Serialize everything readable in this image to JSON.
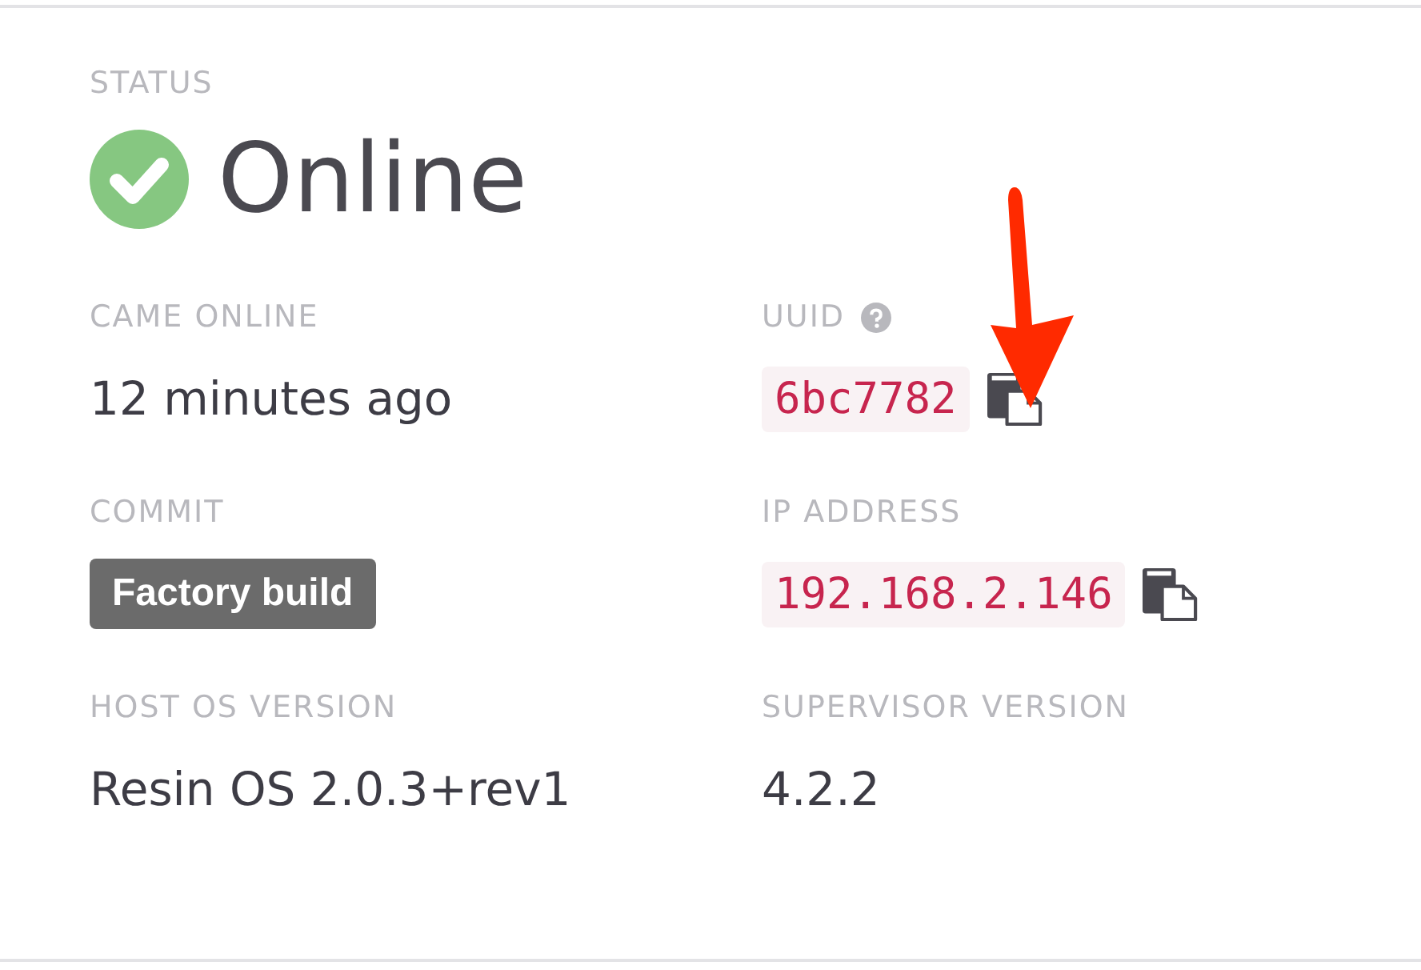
{
  "status": {
    "label": "STATUS",
    "online": true,
    "text": "Online"
  },
  "fields": [
    {
      "label": "CAME ONLINE",
      "value": "12 minutes ago",
      "kind": "text",
      "help": false,
      "copy": false
    },
    {
      "label": "UUID",
      "value": "6bc7782",
      "kind": "code",
      "help": true,
      "copy": true
    },
    {
      "label": "COMMIT",
      "value": "Factory build",
      "kind": "badge",
      "help": false,
      "copy": false
    },
    {
      "label": "IP ADDRESS",
      "value": "192.168.2.146",
      "kind": "code",
      "help": false,
      "copy": true
    },
    {
      "label": "HOST OS VERSION",
      "value": "Resin OS 2.0.3+rev1",
      "kind": "text",
      "help": false,
      "copy": false
    },
    {
      "label": "SUPERVISOR VERSION",
      "value": "4.2.2",
      "kind": "text",
      "help": false,
      "copy": false
    }
  ]
}
